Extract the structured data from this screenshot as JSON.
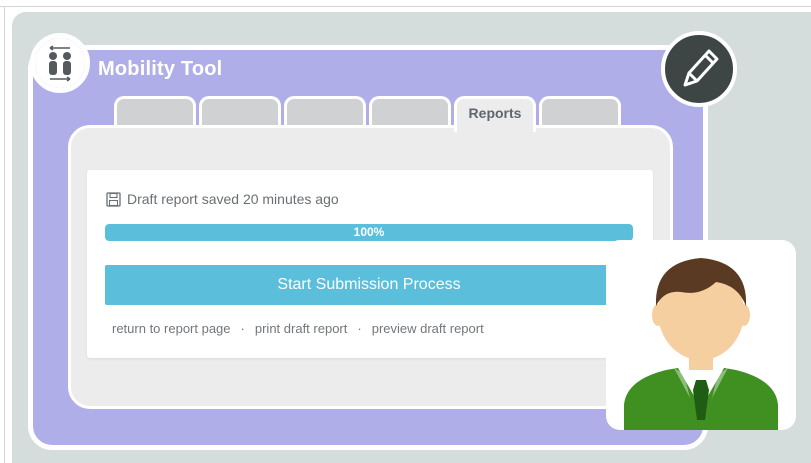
{
  "app": {
    "title": "Mobility Tool",
    "logo_icon": "people-exchange-icon",
    "edit_icon": "pen-icon"
  },
  "tabs": [
    {
      "label": ""
    },
    {
      "label": ""
    },
    {
      "label": ""
    },
    {
      "label": ""
    },
    {
      "label": "Reports",
      "active": true
    },
    {
      "label": ""
    }
  ],
  "report": {
    "save_icon": "floppy-disk-icon",
    "save_status": "Draft report saved 20 minutes ago",
    "progress_label": "100%",
    "progress_fraction": 1.0,
    "submit_label": "Start Submission Process",
    "links": {
      "return": "return to report page",
      "print": "print draft report",
      "preview": "preview draft report",
      "separator": "·"
    }
  },
  "avatar": {
    "icon": "user-avatar-icon"
  },
  "colors": {
    "frame": "#afaee9",
    "accent": "#5bbfdc",
    "pen_badge": "#3d4545",
    "suit": "#3f8f21",
    "hair": "#5a3a22",
    "skin": "#f6cfa0"
  }
}
